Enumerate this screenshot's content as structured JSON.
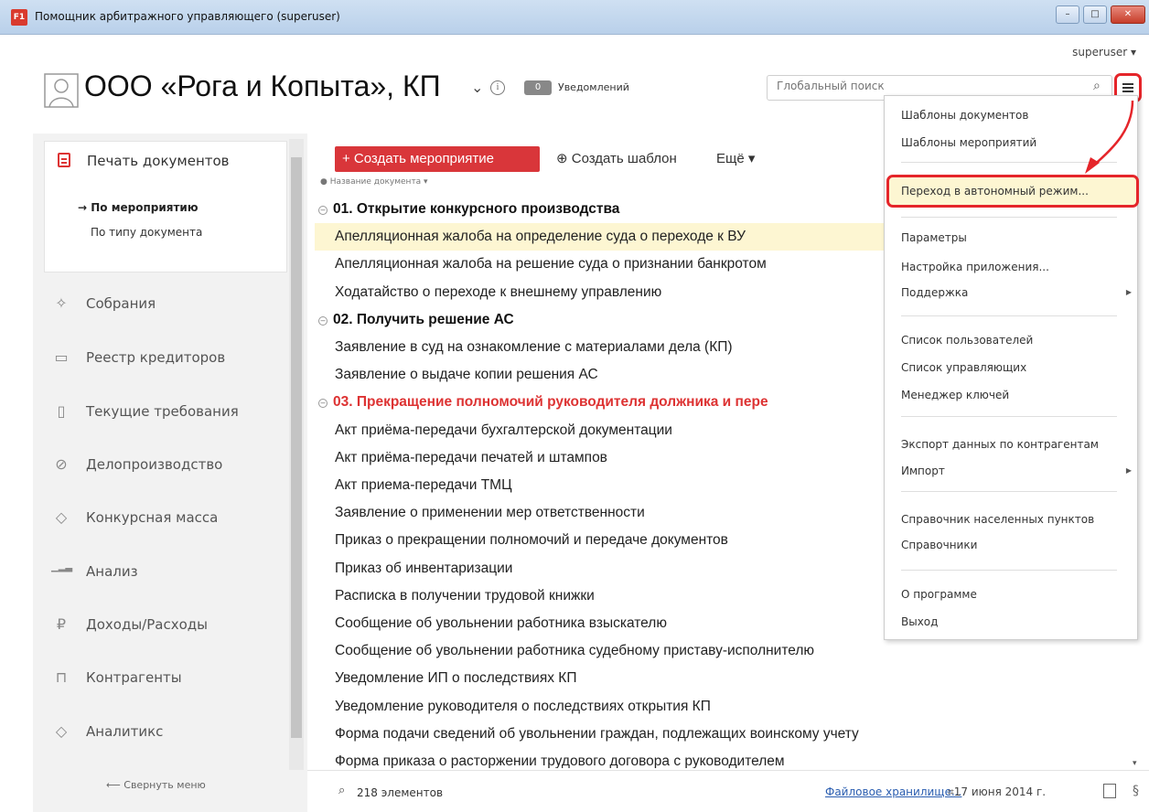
{
  "window": {
    "title": "Помощник арбитражного управляющего (superuser)",
    "icon_text": "F1",
    "min": "–",
    "max": "□",
    "close": "✕"
  },
  "user": {
    "name": "superuser",
    "caret": "▾"
  },
  "header": {
    "org_title": "ООО «Рога и Копыта», КП",
    "notif_count": "0",
    "notif_label": "Уведомлений"
  },
  "search": {
    "placeholder": "Глобальный поиск",
    "value": ""
  },
  "sidebar": {
    "print": "Печать документов",
    "sub_selected": "→ По мероприятию",
    "sub_other": "По типу документа",
    "items": [
      {
        "label": "Собрания",
        "icon": "handshake-icon",
        "glyph": "✧"
      },
      {
        "label": "Реестр кредиторов",
        "icon": "id-card-icon",
        "glyph": "▭"
      },
      {
        "label": "Текущие требования",
        "icon": "document-icon",
        "glyph": "▯"
      },
      {
        "label": "Делопроизводство",
        "icon": "paperclip-icon",
        "glyph": "⊘"
      },
      {
        "label": "Конкурсная масса",
        "icon": "box-icon",
        "glyph": "◇"
      },
      {
        "label": "Анализ",
        "icon": "bar-chart-icon",
        "glyph": "▁▂▃"
      },
      {
        "label": "Доходы/Расходы",
        "icon": "ruble-icon",
        "glyph": "₽"
      },
      {
        "label": "Контрагенты",
        "icon": "bank-icon",
        "glyph": "⊓"
      },
      {
        "label": "Аналитикс",
        "icon": "analytics-icon",
        "glyph": "◇"
      }
    ],
    "collapse": "⟵ Свернуть меню"
  },
  "toolbar": {
    "create_event": "+ Создать мероприятие",
    "create_template": "⊕ Создать шаблон",
    "more": "Ещё ▾"
  },
  "list": {
    "column_header": "Название документа ▾",
    "rows": [
      {
        "type": "group",
        "text": "01. Открытие конкурсного производства"
      },
      {
        "type": "doc",
        "text": "Апелляционная жалоба на определение суда о переходе к ВУ",
        "selected": true
      },
      {
        "type": "doc",
        "text": "Апелляционная жалоба на решение суда о признании банкротом"
      },
      {
        "type": "doc",
        "text": "Ходатайство о переходе к внешнему управлению"
      },
      {
        "type": "group",
        "text": "02. Получить решение АС"
      },
      {
        "type": "doc",
        "text": "Заявление в суд на ознакомление с материалами дела (КП)"
      },
      {
        "type": "doc",
        "text": "Заявление о выдаче копии решения АС"
      },
      {
        "type": "group-red",
        "text": "03. Прекращение полномочий руководителя должника и пере"
      },
      {
        "type": "doc",
        "text": "Акт приёма-передачи бухгалтерской документации"
      },
      {
        "type": "doc",
        "text": "Акт приёма-передачи печатей и штампов"
      },
      {
        "type": "doc",
        "text": "Акт приема-передачи ТМЦ"
      },
      {
        "type": "doc",
        "text": "Заявление о применении мер ответственности"
      },
      {
        "type": "doc",
        "text": "Приказ о прекращении полномочий и передаче документов"
      },
      {
        "type": "doc",
        "text": "Приказ об инвентаризации"
      },
      {
        "type": "doc",
        "text": "Расписка в получении трудовой книжки"
      },
      {
        "type": "doc",
        "text": "Сообщение об увольнении работника взыскателю"
      },
      {
        "type": "doc",
        "text": "Сообщение об увольнении работника судебному приставу-исполнителю"
      },
      {
        "type": "doc",
        "text": "Уведомление ИП о последствиях КП"
      },
      {
        "type": "doc",
        "text": "Уведомление руководителя о последствиях открытия КП"
      },
      {
        "type": "doc",
        "text": "Форма подачи сведений об увольнении граждан, подлежащих воинскому учету"
      },
      {
        "type": "doc",
        "text": "Форма приказа о расторжении трудового договора с руководителем"
      }
    ]
  },
  "status": {
    "count": "218 элементов",
    "storage": "Файловое хранилище...",
    "date": "17 июня 2014 г."
  },
  "menu": {
    "items": [
      "Шаблоны документов",
      "Шаблоны мероприятий",
      "Переход в автономный режим...",
      "Параметры",
      "Настройка приложения...",
      "Поддержка",
      "Список пользователей",
      "Список управляющих",
      "Менеджер ключей",
      "Экспорт данных по контрагентам",
      "Импорт",
      "Справочник населенных пунктов",
      "Справочники",
      "О программе",
      "Выход"
    ]
  },
  "colors": {
    "accent_red": "#d9363a",
    "highlight_border": "#e5252a",
    "selected_row": "#fdf6d2",
    "link": "#2a5db0"
  }
}
